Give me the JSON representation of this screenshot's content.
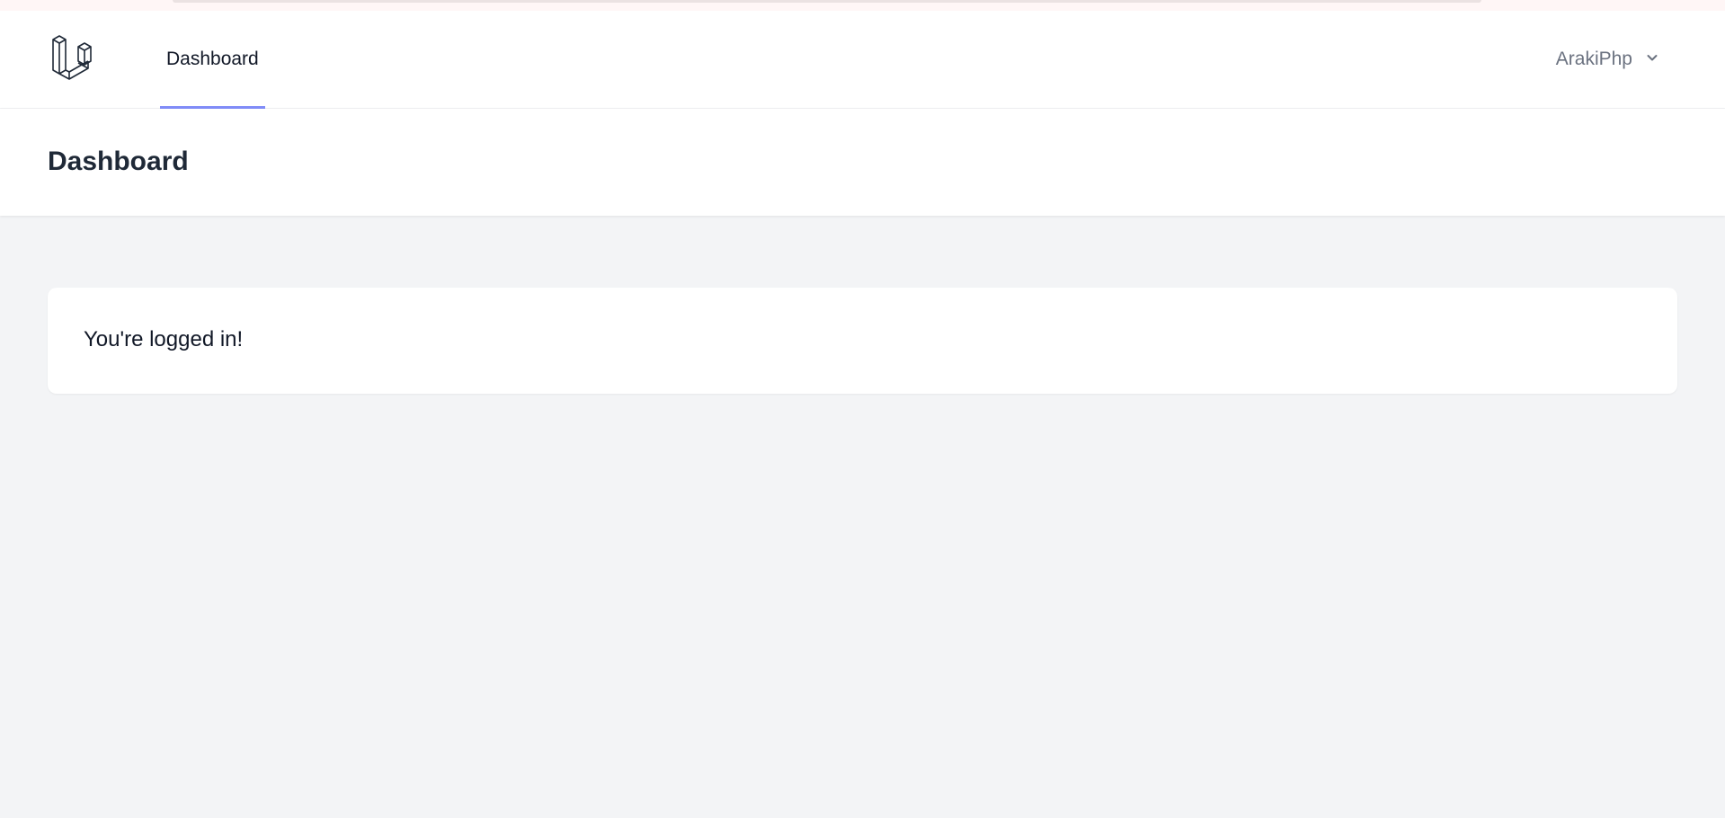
{
  "navigation": {
    "logo_icon": "laravel-logo-icon",
    "links": [
      {
        "label": "Dashboard",
        "active": true
      }
    ],
    "user": {
      "name": "ArakiPhp",
      "dropdown_icon": "chevron-down-icon"
    }
  },
  "header": {
    "title": "Dashboard"
  },
  "main": {
    "message": "You're logged in!"
  },
  "colors": {
    "active_underline": "#818cf8",
    "page_background": "#f3f4f6",
    "user_name": "#6b7280"
  }
}
